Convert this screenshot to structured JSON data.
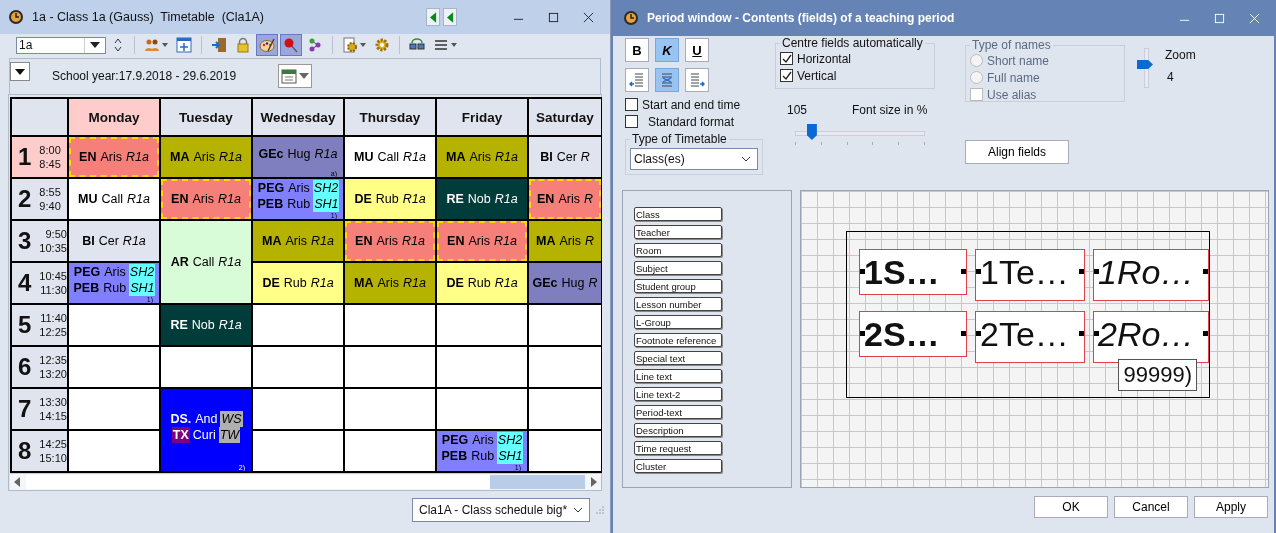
{
  "timetable_window": {
    "title": "1a - Class 1a (Gauss)  Timetable  (Cla1A)",
    "class_select": {
      "value": "1a"
    },
    "toolbar_groups": [
      [
        {
          "kind": "people",
          "pressed": false,
          "dropdown": true
        },
        {
          "kind": "window",
          "pressed": false,
          "dropdown": false
        }
      ],
      [
        {
          "kind": "door",
          "pressed": false,
          "dropdown": false
        },
        {
          "kind": "lock",
          "pressed": false,
          "dropdown": false
        },
        {
          "kind": "palette",
          "pressed": true,
          "dropdown": false
        },
        {
          "kind": "pin",
          "pressed": true,
          "dropdown": false
        },
        {
          "kind": "nodes",
          "pressed": false,
          "dropdown": false
        }
      ],
      [
        {
          "kind": "page_gear",
          "pressed": false,
          "dropdown": true
        },
        {
          "kind": "gear",
          "pressed": false,
          "dropdown": false
        }
      ],
      [
        {
          "kind": "monitors",
          "pressed": false,
          "dropdown": false
        },
        {
          "kind": "list",
          "pressed": false,
          "dropdown": true
        }
      ]
    ],
    "school_year": "School year:17.9.2018 - 29.6.2019",
    "days": [
      {
        "label": "Monday",
        "current": true
      },
      {
        "label": "Tuesday",
        "current": false
      },
      {
        "label": "Wednesday",
        "current": false
      },
      {
        "label": "Thursday",
        "current": false
      },
      {
        "label": "Friday",
        "current": false
      },
      {
        "label": "Saturday",
        "current": false
      }
    ],
    "periods": [
      {
        "number": "1",
        "start": "8:00",
        "end": "8:45",
        "current": true,
        "cells": [
          {
            "kind": "single",
            "color": "#f77f7a",
            "dashed": true,
            "lines": [
              {
                "subject": "EN",
                "teacher": "Aris",
                "room": "R1a",
                "subject_highlight": false,
                "room_highlight": false
              }
            ]
          },
          {
            "kind": "single",
            "color": "#b5b300",
            "dashed": false,
            "lines": [
              {
                "subject": "MA",
                "teacher": "Aris",
                "room": "R1a",
                "subject_highlight": false,
                "room_highlight": false
              }
            ]
          },
          {
            "kind": "single",
            "color": "#7f7fbf",
            "dashed": false,
            "note": "a)",
            "lines": [
              {
                "subject": "GEc",
                "teacher": "Hug",
                "room": "R1a",
                "subject_highlight": false,
                "room_highlight": false
              }
            ]
          },
          {
            "kind": "single",
            "color": "#ffffff",
            "dashed": false,
            "lines": [
              {
                "subject": "MU",
                "teacher": "Call",
                "room": "R1a",
                "subject_highlight": false,
                "room_highlight": false
              }
            ]
          },
          {
            "kind": "single",
            "color": "#b5b300",
            "dashed": false,
            "lines": [
              {
                "subject": "MA",
                "teacher": "Aris",
                "room": "R1a",
                "subject_highlight": false,
                "room_highlight": false
              }
            ]
          },
          {
            "kind": "single",
            "color": "#dfe4ee",
            "dashed": false,
            "lines": [
              {
                "subject": "BI",
                "teacher": "Cer",
                "room": "R",
                "subject_highlight": false,
                "room_highlight": false
              }
            ]
          }
        ]
      },
      {
        "number": "2",
        "start": "8:55",
        "end": "9:40",
        "current": false,
        "cells": [
          {
            "kind": "single",
            "color": "#ffffff",
            "dashed": false,
            "lines": [
              {
                "subject": "MU",
                "teacher": "Call",
                "room": "R1a",
                "subject_highlight": false,
                "room_highlight": false
              }
            ]
          },
          {
            "kind": "single",
            "color": "#f77f7a",
            "dashed": true,
            "lines": [
              {
                "subject": "EN",
                "teacher": "Aris",
                "room": "R1a",
                "subject_highlight": false,
                "room_highlight": false
              }
            ]
          },
          {
            "kind": "single",
            "color": "#8080ff",
            "dashed": false,
            "note": "1)",
            "lines": [
              {
                "subject": "PEG",
                "teacher": "Aris",
                "room": "SH2",
                "subject_highlight": false,
                "room_highlight": true
              },
              {
                "subject": "PEB",
                "teacher": "Rub",
                "room": "SH1",
                "subject_highlight": false,
                "room_highlight": true
              }
            ]
          },
          {
            "kind": "single",
            "color": "#ffff88",
            "dashed": false,
            "lines": [
              {
                "subject": "DE",
                "teacher": "Rub",
                "room": "R1a",
                "subject_highlight": false,
                "room_highlight": false
              }
            ]
          },
          {
            "kind": "single",
            "color": "#003c3a",
            "dashed": false,
            "lines": [
              {
                "subject": "RE",
                "teacher": "Nob",
                "room": "R1a",
                "subject_highlight": false,
                "room_highlight": false
              }
            ]
          },
          {
            "kind": "single",
            "color": "#f77f7a",
            "dashed": true,
            "lines": [
              {
                "subject": "EN",
                "teacher": "Aris",
                "room": "R",
                "subject_highlight": false,
                "room_highlight": false
              }
            ]
          }
        ]
      },
      {
        "number": "3",
        "start": "9:50",
        "end": "10:35",
        "current": false,
        "cells": [
          {
            "kind": "single",
            "color": "#dfe4ee",
            "dashed": false,
            "lines": [
              {
                "subject": "BI",
                "teacher": "Cer",
                "room": "R1a",
                "subject_highlight": false,
                "room_highlight": false
              }
            ]
          },
          {
            "kind": "double",
            "color": "#d8fbd8",
            "dashed": false,
            "lines": [
              {
                "subject": "AR",
                "teacher": "Call",
                "room": "R1a",
                "subject_highlight": false,
                "room_highlight": false
              }
            ]
          },
          {
            "kind": "single",
            "color": "#b5b300",
            "dashed": false,
            "lines": [
              {
                "subject": "MA",
                "teacher": "Aris",
                "room": "R1a",
                "subject_highlight": false,
                "room_highlight": false
              }
            ]
          },
          {
            "kind": "single",
            "color": "#f77f7a",
            "dashed": true,
            "lines": [
              {
                "subject": "EN",
                "teacher": "Aris",
                "room": "R1a",
                "subject_highlight": false,
                "room_highlight": false
              }
            ]
          },
          {
            "kind": "single",
            "color": "#f77f7a",
            "dashed": true,
            "lines": [
              {
                "subject": "EN",
                "teacher": "Aris",
                "room": "R1a",
                "subject_highlight": false,
                "room_highlight": false
              }
            ]
          },
          {
            "kind": "single",
            "color": "#b5b300",
            "dashed": false,
            "lines": [
              {
                "subject": "MA",
                "teacher": "Aris",
                "room": "R",
                "subject_highlight": false,
                "room_highlight": false
              }
            ]
          }
        ]
      },
      {
        "number": "4",
        "start": "10:45",
        "end": "11:30",
        "current": false,
        "cells": [
          {
            "kind": "single",
            "color": "#8080ff",
            "dashed": false,
            "note": "1)",
            "lines": [
              {
                "subject": "PEG",
                "teacher": "Aris",
                "room": "SH2",
                "subject_highlight": false,
                "room_highlight": true
              },
              {
                "subject": "PEB",
                "teacher": "Rub",
                "room": "SH1",
                "subject_highlight": false,
                "room_highlight": true
              }
            ]
          },
          {
            "kind": "single",
            "color": "#ffff88",
            "dashed": false,
            "lines": [
              {
                "subject": "DE",
                "teacher": "Rub",
                "room": "R1a",
                "subject_highlight": false,
                "room_highlight": false
              }
            ]
          },
          {
            "kind": "single",
            "color": "#b5b300",
            "dashed": false,
            "lines": [
              {
                "subject": "MA",
                "teacher": "Aris",
                "room": "R1a",
                "subject_highlight": false,
                "room_highlight": false
              }
            ]
          },
          {
            "kind": "single",
            "color": "#ffff88",
            "dashed": false,
            "lines": [
              {
                "subject": "DE",
                "teacher": "Rub",
                "room": "R1a",
                "subject_highlight": false,
                "room_highlight": false
              }
            ]
          },
          {
            "kind": "single",
            "color": "#7f7fbf",
            "dashed": false,
            "lines": [
              {
                "subject": "GEc",
                "teacher": "Hug",
                "room": "R",
                "subject_highlight": false,
                "room_highlight": false
              }
            ]
          }
        ]
      },
      {
        "number": "5",
        "start": "11:40",
        "end": "12:25",
        "current": false,
        "cells": [
          {
            "kind": "empty"
          },
          {
            "kind": "single",
            "color": "#003c3a",
            "dashed": false,
            "lines": [
              {
                "subject": "RE",
                "teacher": "Nob",
                "room": "R1a",
                "subject_highlight": false,
                "room_highlight": false
              }
            ]
          },
          {
            "kind": "empty"
          },
          {
            "kind": "empty"
          },
          {
            "kind": "empty"
          },
          {
            "kind": "empty"
          }
        ]
      },
      {
        "number": "6",
        "start": "12:35",
        "end": "13:20",
        "current": false,
        "cells": [
          {
            "kind": "empty"
          },
          {
            "kind": "empty"
          },
          {
            "kind": "empty"
          },
          {
            "kind": "empty"
          },
          {
            "kind": "empty"
          },
          {
            "kind": "empty"
          }
        ]
      },
      {
        "number": "7",
        "start": "13:30",
        "end": "14:15",
        "current": false,
        "cells": [
          {
            "kind": "empty"
          },
          {
            "kind": "double",
            "color": "#0000ff",
            "dashed": false,
            "note": "2)",
            "lines": [
              {
                "subject": "DS.",
                "teacher": "And",
                "room": "WS",
                "subject_highlight": false,
                "room_highlight": true
              },
              {
                "subject": "TX",
                "teacher": "Curi",
                "room": "TW",
                "subject_highlight": true,
                "room_highlight": true
              }
            ]
          },
          {
            "kind": "empty"
          },
          {
            "kind": "empty"
          },
          {
            "kind": "empty"
          },
          {
            "kind": "empty"
          }
        ]
      },
      {
        "number": "8",
        "start": "14:25",
        "end": "15:10",
        "current": false,
        "cells": [
          {
            "kind": "empty"
          },
          {
            "kind": "empty"
          },
          {
            "kind": "empty"
          },
          {
            "kind": "single",
            "color": "#8080ff",
            "dashed": false,
            "note": "1)",
            "lines": [
              {
                "subject": "PEG",
                "teacher": "Aris",
                "room": "SH2",
                "subject_highlight": false,
                "room_highlight": true
              },
              {
                "subject": "PEB",
                "teacher": "Rub",
                "room": "SH1",
                "subject_highlight": false,
                "room_highlight": true
              }
            ]
          },
          {
            "kind": "empty"
          }
        ]
      }
    ],
    "layout_select": {
      "value": "Cla1A - Class schedule big*"
    }
  },
  "period_window": {
    "title": "Period window - Contents (fields) of a teaching period",
    "format_buttons": [
      {
        "kind": "bold",
        "label": "B",
        "pressed": false
      },
      {
        "kind": "italic",
        "label": "K",
        "pressed": true
      },
      {
        "kind": "underline",
        "label": "U",
        "pressed": false
      }
    ],
    "align_buttons": [
      {
        "kind": "left",
        "pressed": false
      },
      {
        "kind": "center",
        "pressed": true
      },
      {
        "kind": "right",
        "pressed": false
      }
    ],
    "options": [
      {
        "label": "Start and end time",
        "checked": false
      },
      {
        "label": "Standard format",
        "checked": false
      }
    ],
    "timetable_type": {
      "label": "Type of Timetable",
      "value": "Class(es)"
    },
    "centre_fields": {
      "label": "Centre fields automatically",
      "options": [
        {
          "label": "Horizontal",
          "checked": true
        },
        {
          "label": "Vertical",
          "checked": true
        }
      ]
    },
    "font_size": {
      "value": "105",
      "label": "Font size in %",
      "level": 0.13
    },
    "names": {
      "label": "Type of names",
      "disabled": true,
      "options": [
        {
          "label": "Short name",
          "selected": false
        },
        {
          "label": "Full name",
          "selected": false
        }
      ],
      "alias": {
        "label": "Use alias",
        "checked": false
      }
    },
    "zoom": {
      "label": "Zoom",
      "value": "4",
      "level": 0.6
    },
    "align_fields": "Align fields",
    "field_list": [
      "Class",
      "Teacher",
      "Room",
      "Subject",
      "Student group",
      "Lesson number",
      "L-Group",
      "Footnote reference",
      "Special text",
      "Line text",
      "Line text-2",
      "Period-text",
      "Description",
      "Time request",
      "Cluster"
    ],
    "layout": {
      "rows": [
        [
          {
            "text": "1S…",
            "kind": "bold"
          },
          {
            "text": "1Te…",
            "kind": "normal"
          },
          {
            "text": "1Ro…",
            "kind": "italic"
          }
        ],
        [
          {
            "text": "2S…",
            "kind": "bold"
          },
          {
            "text": "2Te…",
            "kind": "normal"
          },
          {
            "text": "2Ro…",
            "kind": "italic"
          }
        ]
      ],
      "footnote": "99999)"
    },
    "buttons": [
      "OK",
      "Cancel",
      "Apply"
    ]
  }
}
